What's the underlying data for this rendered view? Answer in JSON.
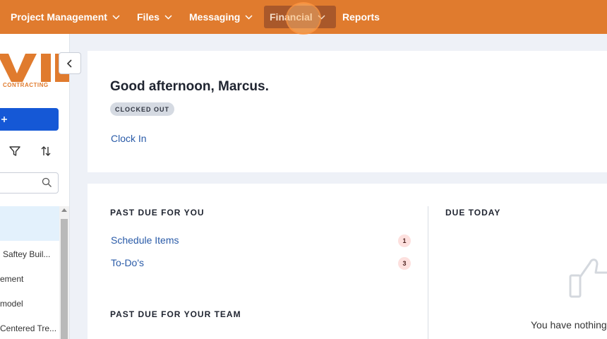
{
  "topnav": {
    "items": [
      {
        "label": "Project Management"
      },
      {
        "label": "Files"
      },
      {
        "label": "Messaging"
      },
      {
        "label": "Financial",
        "active": true
      },
      {
        "label": "Reports"
      }
    ]
  },
  "sidebar": {
    "logo_text": "VI",
    "logo_tagline": "CONTRACTING",
    "list_items": [
      {
        "label": ""
      },
      {
        "label": "Saftey Buil..."
      },
      {
        "label": "ement"
      },
      {
        "label": "model"
      },
      {
        "label": "Centered Tre..."
      }
    ]
  },
  "greeting": {
    "title": "Good afternoon, Marcus.",
    "status": "CLOCKED OUT",
    "action": "Clock In"
  },
  "past_due_you": {
    "heading": "PAST DUE FOR YOU",
    "items": [
      {
        "label": "Schedule Items",
        "count": "1"
      },
      {
        "label": "To-Do's",
        "count": "3"
      }
    ]
  },
  "past_due_team": {
    "heading": "PAST DUE FOR YOUR TEAM"
  },
  "due_today": {
    "heading": "DUE TODAY",
    "empty_text": "You have nothing"
  },
  "colors": {
    "nav_bg": "#e07b2e",
    "primary_button": "#1558d6",
    "link": "#2a5ba8"
  }
}
